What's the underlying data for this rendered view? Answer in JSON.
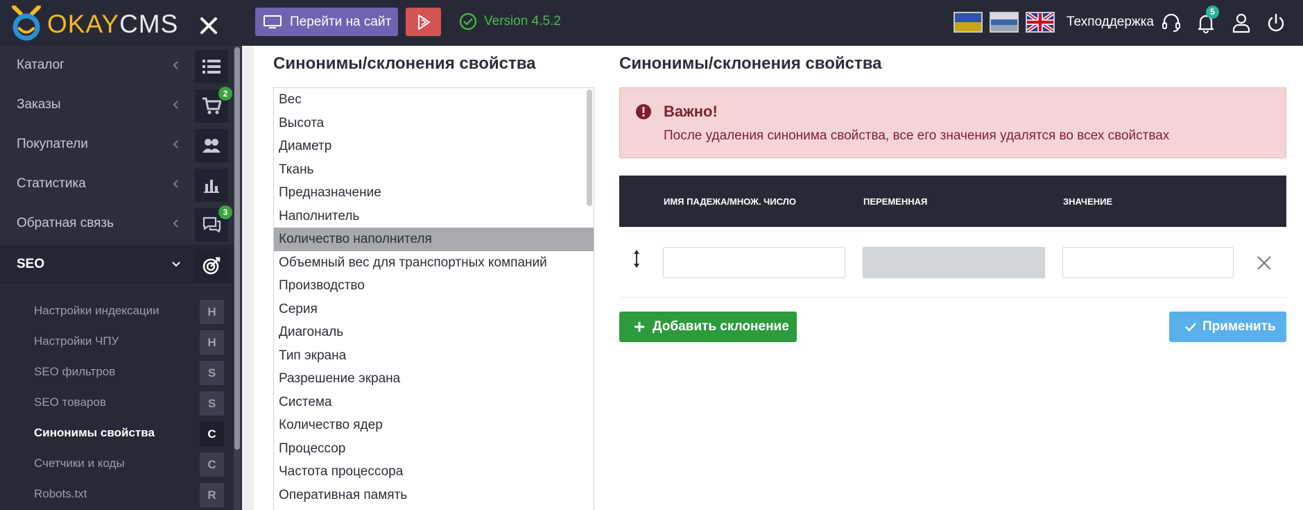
{
  "logo": {
    "okay": "OKAY",
    "cms": "CMS"
  },
  "topbar": {
    "goto_site": "Перейти на сайт",
    "version": "Version 4.5.2",
    "support": "Техподдержка",
    "notifications_count": "5",
    "flags": [
      "ua",
      "ru",
      "en"
    ]
  },
  "sidebar": {
    "items": [
      {
        "label": "Каталог",
        "icon": "list-icon",
        "badge": ""
      },
      {
        "label": "Заказы",
        "icon": "cart-icon",
        "badge": "2"
      },
      {
        "label": "Покупатели",
        "icon": "users-icon",
        "badge": ""
      },
      {
        "label": "Статистика",
        "icon": "bar-chart-icon",
        "badge": ""
      },
      {
        "label": "Обратная связь",
        "icon": "chat-icon",
        "badge": "3"
      },
      {
        "label": "SEO",
        "icon": "target-icon",
        "badge": ""
      }
    ],
    "submenu": [
      {
        "label": "Настройки индексации",
        "letter": "Н"
      },
      {
        "label": "Настройки ЧПУ",
        "letter": "Н"
      },
      {
        "label": "SEO фильтров",
        "letter": "S"
      },
      {
        "label": "SEO товаров",
        "letter": "S"
      },
      {
        "label": "Синонимы свойства",
        "letter": "С"
      },
      {
        "label": "Счетчики и коды",
        "letter": "С"
      },
      {
        "label": "Robots.txt",
        "letter": "R"
      }
    ]
  },
  "left_panel": {
    "title": "Синонимы/склонения свойства",
    "items": [
      "Вес",
      "Высота",
      "Диаметр",
      "Ткань",
      "Предназначение",
      "Наполнитель",
      "Количество наполнителя",
      "Объемный вес для транспортных компаний",
      "Производство",
      "Серия",
      "Диагональ",
      "Тип экрана",
      "Разрешение экрана",
      "Система",
      "Количество ядер",
      "Процессор",
      "Частота процессора",
      "Оперативная память"
    ],
    "selected_index": 6
  },
  "right_panel": {
    "title": "Синонимы/склонения свойства",
    "alert": {
      "title": "Важно!",
      "text": "После удаления синонима свойства, все его значения удалятся во всех свойствах"
    },
    "table": {
      "col_case": "ИМЯ ПАДЕЖА/МНОЖ. ЧИСЛО",
      "col_variable": "ПЕРЕМЕННАЯ",
      "col_value": "ЗНАЧЕНИЕ"
    },
    "row": {
      "case_value": "",
      "variable_value": "",
      "value_value": ""
    },
    "add_button": "Добавить склонение",
    "apply_button": "Применить"
  },
  "colors": {
    "sidebar_bg": "#2b2e3b",
    "topbar_bg": "#272a36",
    "accent_purple": "#6f63b2",
    "accent_red": "#d45454",
    "version_green": "#4bbd48",
    "add_green": "#2d9a3e",
    "apply_blue": "#5ab0ea",
    "alert_bg": "#f5d4d6"
  }
}
